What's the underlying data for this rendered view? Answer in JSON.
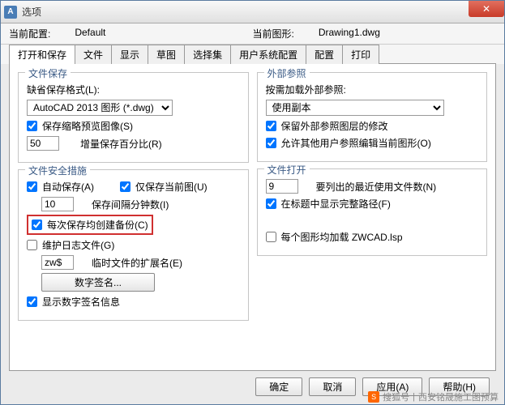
{
  "window": {
    "title": "选项",
    "icon_text": "A"
  },
  "info": {
    "current_config_label": "当前配置:",
    "current_config": "Default",
    "current_drawing_label": "当前图形:",
    "current_drawing": "Drawing1.dwg"
  },
  "tabs": [
    "打开和保存",
    "文件",
    "显示",
    "草图",
    "选择集",
    "用户系统配置",
    "配置",
    "打印"
  ],
  "active_tab": 0,
  "left": {
    "filesave": {
      "title": "文件保存",
      "default_format_label": "缺省保存格式(L):",
      "default_format_value": "AutoCAD 2013 图形 (*.dwg)",
      "thumb_label": "保存缩略预览图像(S)",
      "increment_value": "50",
      "increment_label": "增量保存百分比(R)"
    },
    "safety": {
      "title": "文件安全措施",
      "autosave_label": "自动保存(A)",
      "curonly_label": "仅保存当前图(U)",
      "interval_value": "10",
      "interval_label": "保存间隔分钟数(I)",
      "backup_label": "每次保存均创建备份(C)",
      "logfile_label": "维护日志文件(G)",
      "tempext_value": "zw$",
      "tempext_label": "临时文件的扩展名(E)",
      "signature_btn": "数字签名...",
      "showsig_label": "显示数字签名信息"
    }
  },
  "right": {
    "xref": {
      "title": "外部参照",
      "demand_label": "按需加载外部参照:",
      "demand_value": "使用副本",
      "retain_label": "保留外部参照图层的修改",
      "allow_label": "允许其他用户参照编辑当前图形(O)"
    },
    "fileopen": {
      "title": "文件打开",
      "recent_value": "9",
      "recent_label": "要列出的最近使用文件数(N)",
      "fullpath_label": "在标题中显示完整路径(F)",
      "load_label": "每个图形均加载 ZWCAD.lsp"
    }
  },
  "buttons": {
    "ok": "确定",
    "cancel": "取消",
    "apply": "应用(A)",
    "help": "帮助(H)"
  },
  "watermark": {
    "source": "搜狐号",
    "author": "西安铭晟施工图预算"
  }
}
